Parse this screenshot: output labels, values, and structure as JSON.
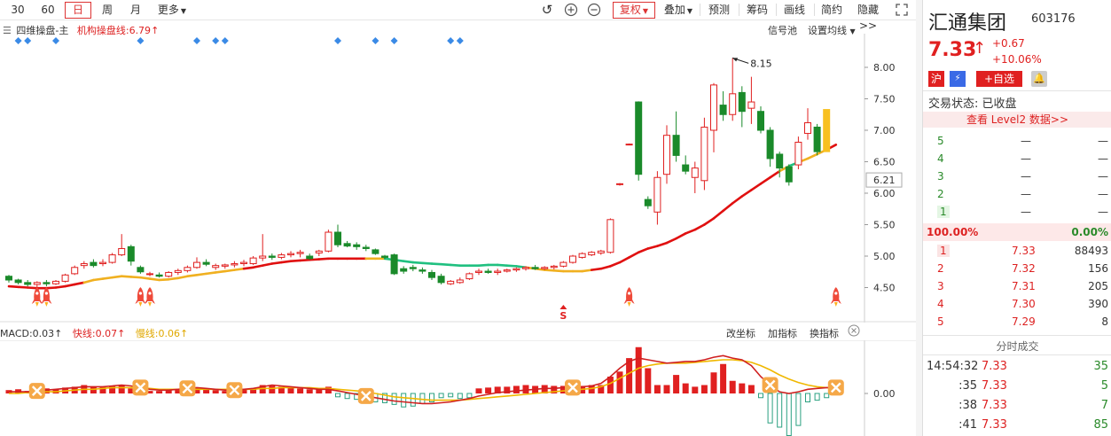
{
  "toolbar": {
    "periods": [
      "30",
      "60",
      "日",
      "周",
      "月"
    ],
    "active_period": "日",
    "more_label": "更多",
    "right_buttons": [
      "复权",
      "叠加",
      "预测",
      "筹码",
      "画线",
      "简约",
      "隐藏>>"
    ]
  },
  "main_chart": {
    "indicator_name": "四维操盘-主",
    "line_label": "机构操盘线:6.79",
    "signal_label": "信号池",
    "avg_label": "设置均线",
    "high_label": "8.15",
    "current_price_label": "6.21",
    "s_marker": "S",
    "y_ticks": [
      "8.00",
      "7.50",
      "7.00",
      "6.50",
      "6.00",
      "5.50",
      "5.00",
      "4.50"
    ],
    "candles": [
      [
        4.68,
        4.7,
        4.58,
        4.62
      ],
      [
        4.62,
        4.64,
        4.55,
        4.58
      ],
      [
        4.58,
        4.62,
        4.52,
        4.55
      ],
      [
        4.55,
        4.6,
        4.5,
        4.58
      ],
      [
        4.58,
        4.62,
        4.52,
        4.56
      ],
      [
        4.56,
        4.62,
        4.54,
        4.6
      ],
      [
        4.6,
        4.72,
        4.58,
        4.7
      ],
      [
        4.72,
        4.85,
        4.7,
        4.82
      ],
      [
        4.85,
        4.92,
        4.8,
        4.88
      ],
      [
        4.9,
        4.95,
        4.82,
        4.85
      ],
      [
        4.88,
        4.95,
        4.84,
        4.9
      ],
      [
        4.9,
        5.05,
        4.88,
        5.02
      ],
      [
        5.02,
        5.35,
        5.0,
        5.12
      ],
      [
        5.15,
        5.18,
        4.85,
        4.92
      ],
      [
        4.82,
        4.85,
        4.72,
        4.75
      ],
      [
        4.72,
        4.75,
        4.68,
        4.72
      ],
      [
        4.7,
        4.74,
        4.66,
        4.68
      ],
      [
        4.68,
        4.76,
        4.66,
        4.74
      ],
      [
        4.74,
        4.8,
        4.7,
        4.77
      ],
      [
        4.77,
        4.85,
        4.74,
        4.82
      ],
      [
        4.82,
        4.98,
        4.8,
        4.9
      ],
      [
        4.9,
        4.95,
        4.84,
        4.87
      ],
      [
        4.82,
        4.88,
        4.78,
        4.85
      ],
      [
        4.84,
        4.88,
        4.8,
        4.86
      ],
      [
        4.86,
        4.92,
        4.82,
        4.88
      ],
      [
        4.88,
        4.94,
        4.84,
        4.9
      ],
      [
        4.88,
        5.0,
        4.86,
        4.97
      ],
      [
        4.97,
        5.35,
        4.92,
        5.0
      ],
      [
        5.0,
        5.04,
        4.94,
        4.98
      ],
      [
        4.98,
        5.05,
        4.95,
        5.02
      ],
      [
        5.02,
        5.08,
        4.98,
        5.04
      ],
      [
        5.04,
        5.1,
        4.98,
        5.06
      ],
      [
        5.0,
        5.04,
        4.94,
        4.96
      ],
      [
        5.05,
        5.1,
        5.0,
        5.08
      ],
      [
        5.08,
        5.42,
        5.06,
        5.38
      ],
      [
        5.38,
        5.5,
        5.14,
        5.18
      ],
      [
        5.2,
        5.24,
        5.14,
        5.16
      ],
      [
        5.18,
        5.22,
        5.1,
        5.15
      ],
      [
        5.14,
        5.18,
        5.08,
        5.12
      ],
      [
        5.1,
        5.12,
        5.02,
        5.04
      ],
      [
        5.0,
        5.02,
        4.95,
        4.98
      ],
      [
        5.02,
        5.04,
        4.7,
        4.72
      ],
      [
        4.8,
        4.84,
        4.72,
        4.76
      ],
      [
        4.82,
        4.86,
        4.76,
        4.8
      ],
      [
        4.78,
        4.82,
        4.72,
        4.76
      ],
      [
        4.74,
        4.78,
        4.62,
        4.66
      ],
      [
        4.68,
        4.72,
        4.55,
        4.58
      ],
      [
        4.56,
        4.62,
        4.54,
        4.6
      ],
      [
        4.58,
        4.66,
        4.56,
        4.62
      ],
      [
        4.64,
        4.74,
        4.62,
        4.72
      ],
      [
        4.74,
        4.8,
        4.7,
        4.76
      ],
      [
        4.76,
        4.8,
        4.72,
        4.74
      ],
      [
        4.74,
        4.8,
        4.7,
        4.76
      ],
      [
        4.76,
        4.8,
        4.74,
        4.78
      ],
      [
        4.78,
        4.82,
        4.75,
        4.8
      ],
      [
        4.8,
        4.84,
        4.77,
        4.82
      ],
      [
        4.82,
        4.86,
        4.78,
        4.8
      ],
      [
        4.8,
        4.84,
        4.78,
        4.82
      ],
      [
        4.82,
        4.86,
        4.79,
        4.84
      ],
      [
        4.84,
        4.92,
        4.82,
        4.9
      ],
      [
        4.9,
        5.02,
        4.88,
        5.0
      ],
      [
        4.98,
        5.06,
        4.96,
        5.04
      ],
      [
        5.02,
        5.08,
        5.0,
        5.06
      ],
      [
        5.05,
        5.1,
        5.02,
        5.08
      ],
      [
        5.06,
        5.6,
        5.04,
        5.58
      ],
      [
        6.14,
        6.16,
        6.12,
        6.15
      ],
      [
        6.77,
        6.79,
        6.76,
        6.78
      ],
      [
        7.45,
        7.46,
        6.2,
        6.3
      ],
      [
        5.9,
        5.95,
        5.75,
        5.8
      ],
      [
        5.7,
        6.35,
        5.5,
        6.25
      ],
      [
        6.3,
        7.08,
        6.15,
        6.92
      ],
      [
        6.92,
        7.3,
        6.5,
        6.6
      ],
      [
        6.45,
        6.6,
        6.3,
        6.35
      ],
      [
        6.25,
        6.5,
        6.0,
        6.4
      ],
      [
        6.2,
        7.2,
        6.05,
        7.05
      ],
      [
        7.0,
        7.75,
        6.65,
        7.72
      ],
      [
        7.4,
        7.62,
        7.15,
        7.25
      ],
      [
        7.25,
        8.15,
        7.15,
        7.58
      ],
      [
        7.6,
        7.7,
        7.05,
        7.3
      ],
      [
        7.35,
        7.85,
        7.1,
        7.45
      ],
      [
        7.3,
        7.38,
        6.95,
        7.0
      ],
      [
        7.0,
        7.05,
        6.42,
        6.55
      ],
      [
        6.62,
        6.66,
        6.25,
        6.4
      ],
      [
        6.42,
        6.46,
        6.12,
        6.18
      ],
      [
        6.45,
        6.9,
        6.38,
        6.81
      ],
      [
        6.95,
        7.35,
        6.85,
        7.12
      ],
      [
        7.05,
        7.1,
        6.6,
        6.66
      ],
      [
        6.66,
        7.33,
        6.66,
        7.33
      ]
    ],
    "orl_line": [
      4.52,
      4.51,
      4.5,
      4.49,
      4.49,
      4.5,
      4.52,
      4.55,
      4.58,
      4.62,
      4.64,
      4.66,
      4.68,
      4.67,
      4.66,
      4.64,
      4.62,
      4.63,
      4.65,
      4.68,
      4.7,
      4.72,
      4.74,
      4.76,
      4.78,
      4.8,
      4.82,
      4.85,
      4.88,
      4.9,
      4.92,
      4.93,
      4.94,
      4.95,
      4.96,
      4.96,
      4.96,
      4.96,
      4.96,
      4.96,
      4.96,
      4.94,
      4.92,
      4.9,
      4.89,
      4.88,
      4.87,
      4.86,
      4.85,
      4.85,
      4.85,
      4.86,
      4.86,
      4.85,
      4.84,
      4.82,
      4.8,
      4.78,
      4.77,
      4.76,
      4.76,
      4.76,
      4.78,
      4.8,
      4.84,
      4.9,
      4.98,
      5.06,
      5.12,
      5.16,
      5.21,
      5.28,
      5.36,
      5.42,
      5.5,
      5.6,
      5.72,
      5.84,
      5.95,
      6.05,
      6.15,
      6.25,
      6.35,
      6.43,
      6.49,
      6.55,
      6.62,
      6.69,
      6.77
    ],
    "orl_colors": [
      "r",
      "r",
      "r",
      "r",
      "r",
      "r",
      "r",
      "r",
      "y",
      "y",
      "y",
      "y",
      "y",
      "y",
      "y",
      "y",
      "y",
      "y",
      "y",
      "y",
      "y",
      "y",
      "y",
      "y",
      "y",
      "r",
      "r",
      "r",
      "r",
      "r",
      "r",
      "r",
      "r",
      "r",
      "r",
      "r",
      "r",
      "r",
      "y",
      "y",
      "g",
      "g",
      "g",
      "g",
      "g",
      "g",
      "g",
      "g",
      "g",
      "g",
      "g",
      "g",
      "g",
      "g",
      "g",
      "y",
      "y",
      "y",
      "y",
      "y",
      "y",
      "y",
      "r",
      "r",
      "r",
      "r",
      "r",
      "r",
      "r",
      "r",
      "r",
      "r",
      "r",
      "r",
      "r",
      "r",
      "r",
      "r",
      "r",
      "r",
      "r",
      "r",
      "y",
      "g",
      "y",
      "y",
      "y",
      "r",
      "r"
    ],
    "diamonds": [
      1,
      2,
      5,
      14,
      20,
      22,
      23,
      35,
      39,
      41,
      47,
      48
    ],
    "rockets": [
      3,
      4,
      14,
      15,
      66,
      88
    ]
  },
  "macd": {
    "macd_label": "MACD:0.03",
    "fast_label": "快线:0.07",
    "slow_label": "慢线:0.06",
    "buttons": [
      "改坐标",
      "加指标",
      "换指标"
    ],
    "zero_label": "0.00",
    "bars": [
      0.04,
      0.05,
      0.03,
      0.04,
      0.06,
      0.05,
      0.07,
      0.08,
      0.1,
      0.08,
      0.08,
      0.09,
      0.1,
      0.06,
      0.04,
      0.03,
      0.03,
      0.04,
      0.05,
      0.06,
      0.07,
      0.05,
      0.04,
      0.03,
      0.04,
      0.05,
      0.06,
      0.1,
      0.09,
      0.08,
      0.07,
      0.06,
      0.05,
      0.05,
      0.08,
      -0.04,
      -0.06,
      -0.07,
      -0.09,
      -0.1,
      -0.11,
      -0.13,
      -0.16,
      -0.15,
      -0.12,
      -0.1,
      -0.05,
      -0.04,
      -0.06,
      -0.05,
      0.06,
      0.07,
      0.08,
      0.08,
      0.09,
      0.1,
      0.09,
      0.1,
      0.09,
      0.09,
      0.1,
      0.09,
      0.1,
      0.1,
      0.2,
      0.26,
      0.42,
      0.55,
      0.3,
      0.1,
      0.1,
      0.22,
      0.12,
      0.08,
      0.1,
      0.25,
      0.35,
      0.15,
      0.12,
      0.1,
      -0.05,
      -0.35,
      -0.4,
      -0.5,
      -0.38,
      -0.1,
      -0.08,
      -0.05,
      0.08
    ],
    "fast": [
      0.02,
      0.02,
      0.02,
      0.03,
      0.04,
      0.05,
      0.06,
      0.07,
      0.08,
      0.08,
      0.08,
      0.09,
      0.1,
      0.09,
      0.07,
      0.05,
      0.04,
      0.04,
      0.05,
      0.06,
      0.07,
      0.06,
      0.05,
      0.04,
      0.04,
      0.05,
      0.06,
      0.08,
      0.1,
      0.09,
      0.08,
      0.07,
      0.06,
      0.05,
      0.05,
      0.03,
      0.01,
      -0.01,
      -0.03,
      -0.05,
      -0.07,
      -0.09,
      -0.1,
      -0.11,
      -0.12,
      -0.12,
      -0.11,
      -0.1,
      -0.08,
      -0.06,
      -0.03,
      -0.01,
      0.01,
      0.02,
      0.03,
      0.04,
      0.05,
      0.06,
      0.06,
      0.07,
      0.07,
      0.08,
      0.09,
      0.12,
      0.2,
      0.3,
      0.38,
      0.42,
      0.4,
      0.38,
      0.36,
      0.37,
      0.38,
      0.38,
      0.4,
      0.43,
      0.45,
      0.42,
      0.4,
      0.33,
      0.2,
      0.1,
      0.02,
      0.0,
      0.02,
      0.05,
      0.06,
      0.07,
      0.07
    ],
    "slow": [
      0.0,
      0.0,
      0.01,
      0.01,
      0.02,
      0.02,
      0.03,
      0.04,
      0.05,
      0.05,
      0.06,
      0.07,
      0.07,
      0.07,
      0.07,
      0.06,
      0.05,
      0.05,
      0.05,
      0.05,
      0.05,
      0.05,
      0.05,
      0.05,
      0.05,
      0.05,
      0.05,
      0.06,
      0.06,
      0.07,
      0.07,
      0.07,
      0.07,
      0.06,
      0.06,
      0.05,
      0.04,
      0.03,
      0.02,
      0.0,
      -0.02,
      -0.04,
      -0.05,
      -0.06,
      -0.07,
      -0.08,
      -0.08,
      -0.08,
      -0.08,
      -0.07,
      -0.06,
      -0.05,
      -0.04,
      -0.03,
      -0.02,
      -0.01,
      0.0,
      0.01,
      0.02,
      0.03,
      0.04,
      0.05,
      0.06,
      0.08,
      0.12,
      0.18,
      0.24,
      0.3,
      0.33,
      0.35,
      0.36,
      0.36,
      0.36,
      0.37,
      0.38,
      0.39,
      0.4,
      0.4,
      0.39,
      0.37,
      0.33,
      0.28,
      0.22,
      0.17,
      0.13,
      0.1,
      0.08,
      0.07,
      0.06
    ],
    "x_markers": [
      3,
      14,
      19,
      24,
      38,
      60,
      81,
      88
    ]
  },
  "stock": {
    "name": "汇通集团",
    "code": "603176",
    "price": "7.33",
    "change": "+0.67",
    "change_pct": "+10.06%",
    "tag_hu": "沪",
    "tag_rong": "融",
    "add_watch": "+自选",
    "status": "交易状态: 已收盘",
    "level2": "查看 Level2 数据>>"
  },
  "order_book": {
    "sell": [
      {
        "level": "5",
        "price": "—",
        "vol": "—"
      },
      {
        "level": "4",
        "price": "—",
        "vol": "—"
      },
      {
        "level": "3",
        "price": "—",
        "vol": "—"
      },
      {
        "level": "2",
        "price": "—",
        "vol": "—"
      },
      {
        "level": "1",
        "price": "—",
        "vol": "—"
      }
    ],
    "ratio_left": "100.00%",
    "ratio_right": "0.00%",
    "buy": [
      {
        "level": "1",
        "price": "7.33",
        "vol": "88493"
      },
      {
        "level": "2",
        "price": "7.32",
        "vol": "156"
      },
      {
        "level": "3",
        "price": "7.31",
        "vol": "205"
      },
      {
        "level": "4",
        "price": "7.30",
        "vol": "390"
      },
      {
        "level": "5",
        "price": "7.29",
        "vol": "8"
      }
    ]
  },
  "ticks": {
    "title": "分时成交",
    "rows": [
      {
        "time": "14:54:32",
        "price": "7.33",
        "vol": "35"
      },
      {
        "time": ":35",
        "price": "7.33",
        "vol": "5"
      },
      {
        "time": ":38",
        "price": "7.33",
        "vol": "7"
      },
      {
        "time": ":41",
        "price": "7.33",
        "vol": "85"
      }
    ]
  },
  "colors": {
    "up": "#e02020",
    "down": "#1a8a2a",
    "orl_red": "#e01010",
    "orl_yellow": "#f0b020",
    "orl_green": "#20c080",
    "diamond": "#3a8ae6",
    "fast_line": "#d02020",
    "slow_line": "#f0b800"
  }
}
